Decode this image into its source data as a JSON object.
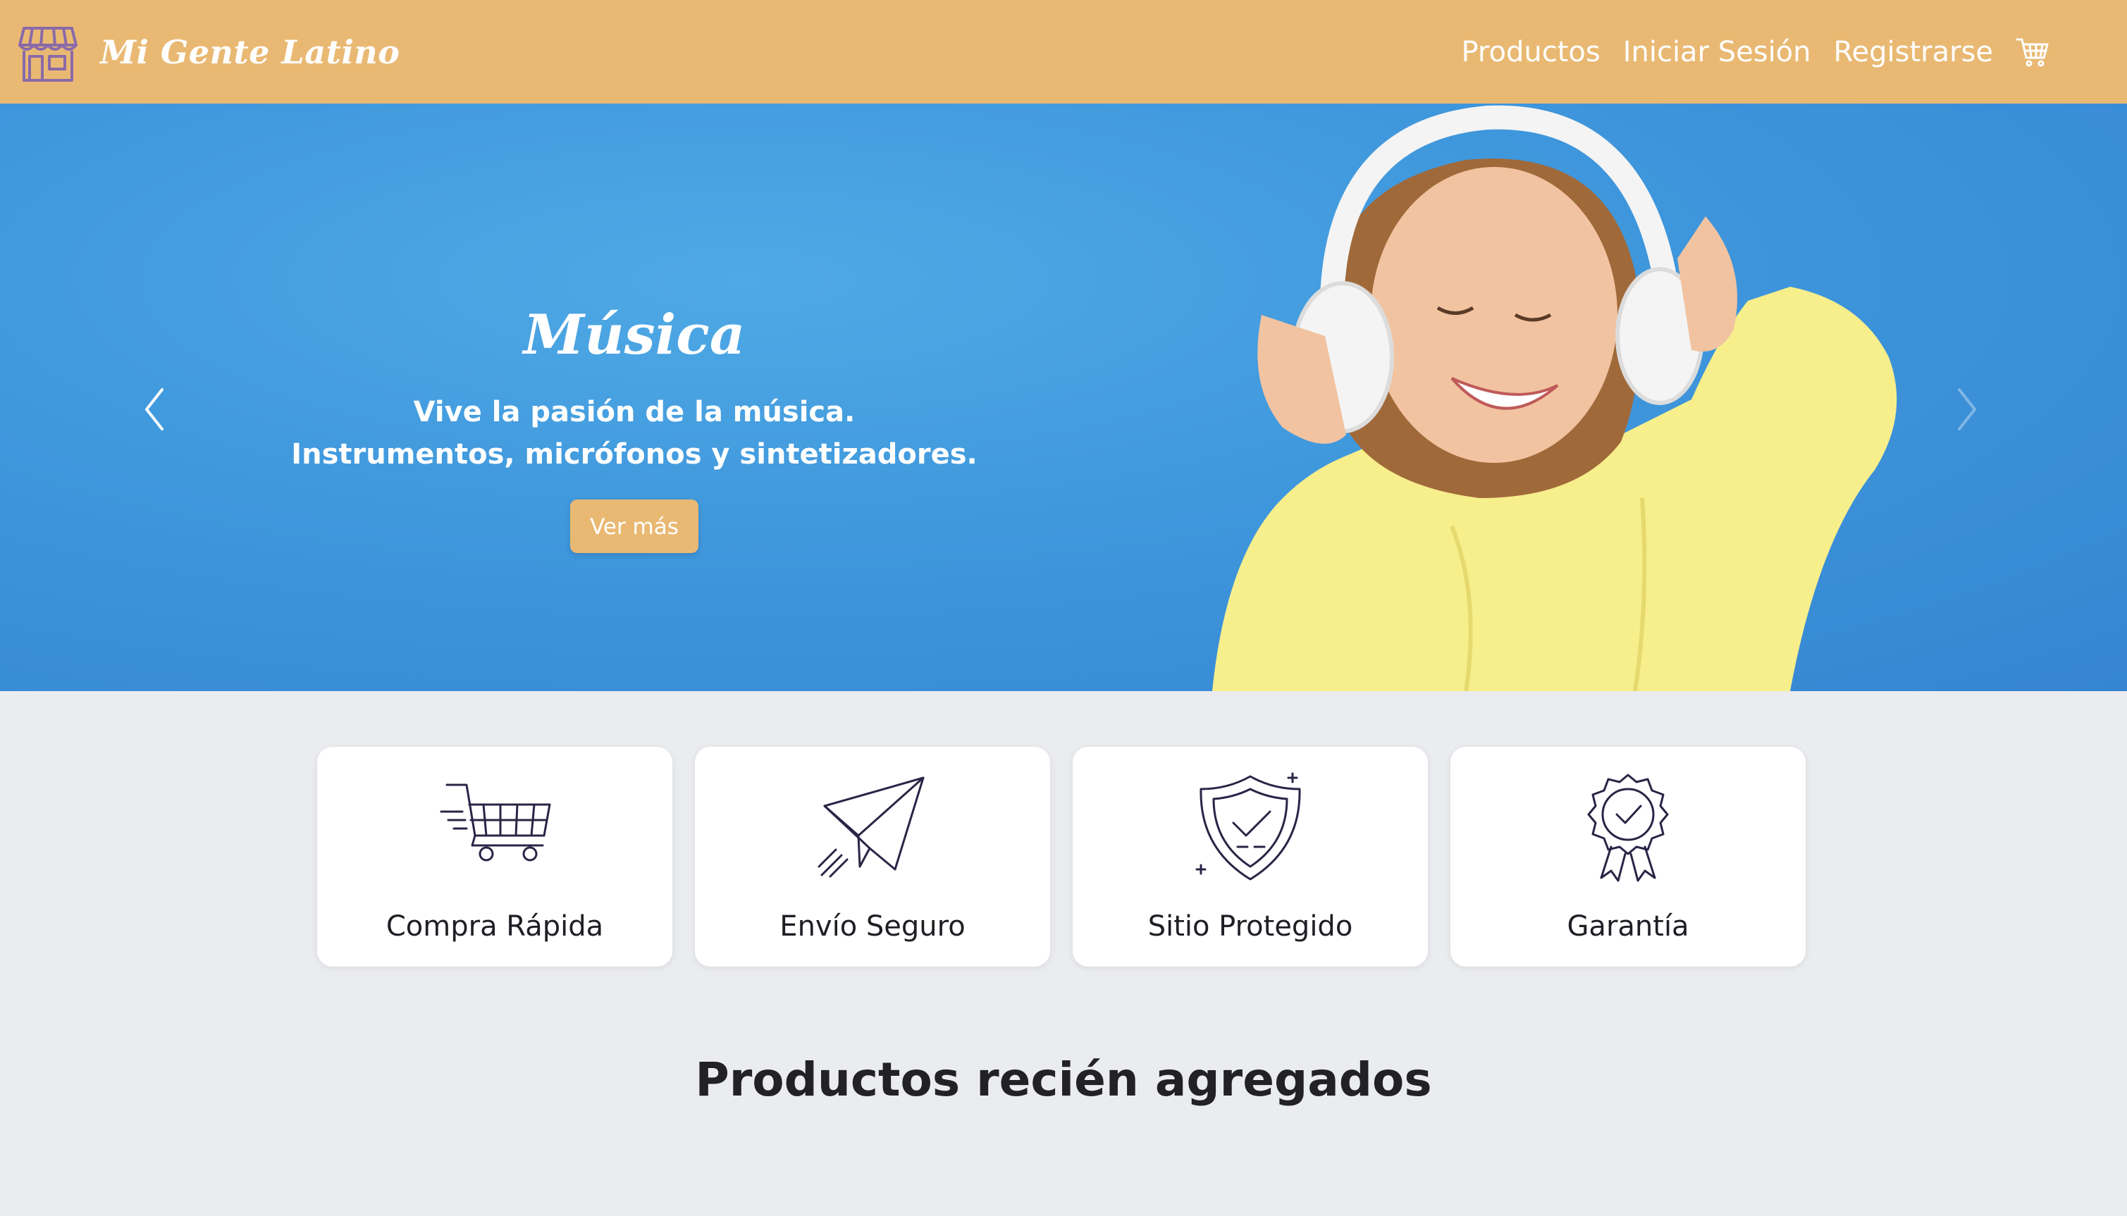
{
  "brand": {
    "name": "Mi Gente Latino",
    "icon": "storefront-icon"
  },
  "nav": {
    "links": [
      "Productos",
      "Iniciar Sesión",
      "Registrarse"
    ],
    "cart_icon": "shopping-cart-icon"
  },
  "hero": {
    "title": "Música",
    "subtitle_line1": "Vive la pasión de la música.",
    "subtitle_line2": "Instrumentos, micrófonos y sintetizadores.",
    "button_label": "Ver más",
    "prev_icon": "chevron-left-icon",
    "next_icon": "chevron-right-icon"
  },
  "features": [
    {
      "label": "Compra Rápida",
      "icon": "fast-cart-icon"
    },
    {
      "label": "Envío Seguro",
      "icon": "paper-plane-icon"
    },
    {
      "label": "Sitio Protegido",
      "icon": "shield-check-icon"
    },
    {
      "label": "Garantía",
      "icon": "award-ribbon-icon"
    }
  ],
  "section": {
    "title": "Productos recién agregados"
  },
  "colors": {
    "navbar": "#e9b973",
    "hero_bg": "#3f97dc",
    "page_bg": "#ebecef",
    "icon_stroke": "#2b2446",
    "brand_icon": "#8a6aa8"
  }
}
